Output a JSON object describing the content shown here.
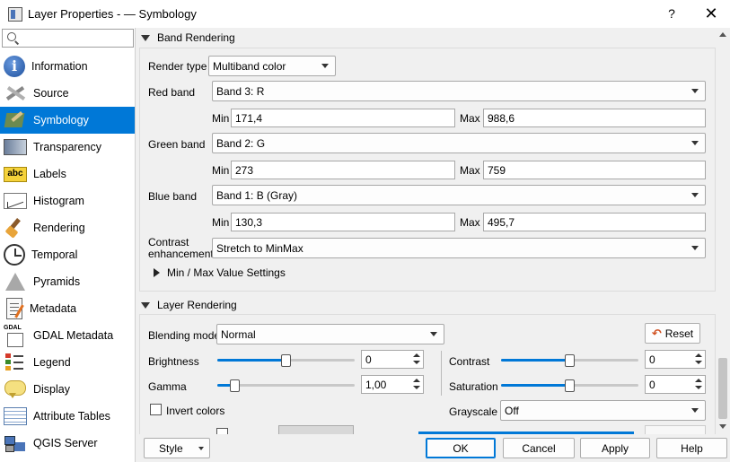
{
  "window": {
    "title": "Layer Properties - — Symbology",
    "help": "?",
    "close": "✕"
  },
  "search": {
    "value": "",
    "placeholder": ""
  },
  "sidebar": {
    "items": [
      {
        "label": "Information",
        "icon": "information-icon"
      },
      {
        "label": "Source",
        "icon": "source-icon"
      },
      {
        "label": "Symbology",
        "icon": "symbology-icon",
        "selected": true
      },
      {
        "label": "Transparency",
        "icon": "transparency-icon"
      },
      {
        "label": "Labels",
        "icon": "labels-icon"
      },
      {
        "label": "Histogram",
        "icon": "histogram-icon"
      },
      {
        "label": "Rendering",
        "icon": "rendering-icon"
      },
      {
        "label": "Temporal",
        "icon": "temporal-icon"
      },
      {
        "label": "Pyramids",
        "icon": "pyramids-icon"
      },
      {
        "label": "Metadata",
        "icon": "metadata-icon"
      },
      {
        "label": "GDAL Metadata",
        "icon": "gdal-metadata-icon"
      },
      {
        "label": "Legend",
        "icon": "legend-icon"
      },
      {
        "label": "Display",
        "icon": "display-icon"
      },
      {
        "label": "Attribute Tables",
        "icon": "attribute-tables-icon"
      },
      {
        "label": "QGIS Server",
        "icon": "qgis-server-icon"
      }
    ]
  },
  "band_rendering": {
    "title": "Band Rendering",
    "render_type_label": "Render type",
    "render_type": "Multiband color",
    "red_label": "Red band",
    "red_band": "Band 3: R",
    "red_min": "171,4",
    "red_max": "988,6",
    "green_label": "Green band",
    "green_band": "Band 2: G",
    "green_min": "273",
    "green_max": "759",
    "blue_label": "Blue band",
    "blue_band": "Band 1: B (Gray)",
    "blue_min": "130,3",
    "blue_max": "495,7",
    "min_label": "Min",
    "max_label": "Max",
    "contrast_label_1": "Contrast",
    "contrast_label_2": "enhancement",
    "contrast": "Stretch to MinMax",
    "minmax_settings": "Min / Max Value Settings"
  },
  "layer_rendering": {
    "title": "Layer Rendering",
    "blending_label": "Blending mode",
    "blending": "Normal",
    "reset": "Reset",
    "brightness_label": "Brightness",
    "brightness": "0",
    "brightness_fraction": 0.5,
    "contrast_label": "Contrast",
    "contrast": "0",
    "contrast_fraction": 0.5,
    "gamma_label": "Gamma",
    "gamma": "1,00",
    "gamma_fraction": 0.1,
    "saturation_label": "Saturation",
    "saturation": "0",
    "saturation_fraction": 0.5,
    "invert_label": "Invert colors",
    "grayscale_label": "Grayscale",
    "grayscale": "Off"
  },
  "footer": {
    "style": "Style",
    "ok": "OK",
    "cancel": "Cancel",
    "apply": "Apply",
    "help": "Help"
  },
  "colors": {
    "accent": "#0078d7",
    "selected_bg": "#0078d7"
  }
}
